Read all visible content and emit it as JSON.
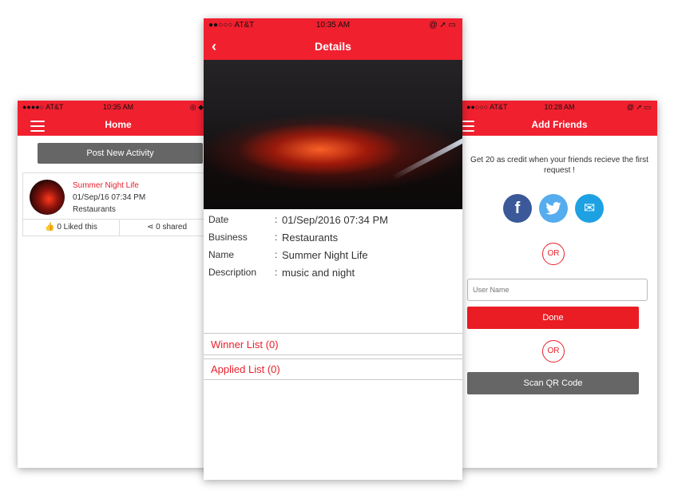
{
  "home": {
    "status": {
      "carrier": "●●●●○ AT&T",
      "time": "10:35 AM",
      "right": "◎ ◆ ▭"
    },
    "title": "Home",
    "post_button": "Post New Activity",
    "activity": {
      "title": "Summer Night Life",
      "date": "01/Sep/16 07:34 PM",
      "category": "Restaurants",
      "likes": "0 Liked this",
      "shares": "0 shared"
    }
  },
  "details": {
    "status": {
      "carrier": "●●○○○ AT&T",
      "time": "10:35 AM",
      "right": "@ ➚ ▭"
    },
    "title": "Details",
    "fields": [
      {
        "label": "Date",
        "value": "01/Sep/2016 07:34 PM"
      },
      {
        "label": "Business",
        "value": "Restaurants"
      },
      {
        "label": "Name",
        "value": "Summer Night Life"
      },
      {
        "label": "Description",
        "value": "music and night"
      }
    ],
    "winner_list": "Winner List (0)",
    "applied_list": "Applied List (0)"
  },
  "friends": {
    "status": {
      "carrier": "●●○○○ AT&T",
      "time": "10:28 AM",
      "right": "@ ➚ ▭"
    },
    "title": "Add Friends",
    "credit_text": "Get 20 as credit when your friends recieve the first request !",
    "or": "OR",
    "username_placeholder": "User Name",
    "done_button": "Done",
    "scan_button": "Scan QR Code",
    "social": {
      "facebook": "f",
      "twitter": "🐦",
      "email": "✉"
    },
    "colors": {
      "facebook": "#3b5998",
      "twitter": "#55acee",
      "email": "#1da1e2"
    }
  },
  "colors": {
    "accent": "#f0202f",
    "gray_button": "#666666"
  }
}
